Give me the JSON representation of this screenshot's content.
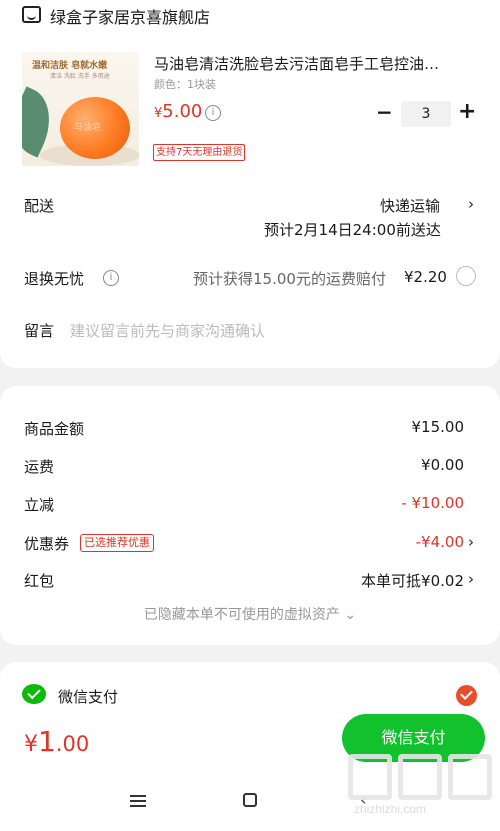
{
  "shop": {
    "name": "绿盒子家居京喜旗舰店",
    "icon": "shop-icon"
  },
  "product": {
    "title": "马油皂清洁洗脸皂去污洁面皂手工皂控油…",
    "variant": "颜色：1块装",
    "price_currency": "¥",
    "price_value": "5.00",
    "quantity": "3",
    "return_badge": "支持7天无理由退货",
    "image": {
      "tagline": "温和洁肤 皂就水嫩",
      "subline": "清洁 洗脸 洗手 多用途",
      "soap_mark": "马油皂"
    }
  },
  "delivery": {
    "label": "配送",
    "method": "快递运输",
    "eta": "预计2月14日24:00前送达"
  },
  "returns": {
    "label": "退换无忧",
    "desc": "预计获得15.00元的运费赔付",
    "price": "¥2.20"
  },
  "note": {
    "label": "留言",
    "placeholder": "建议留言前先与商家沟通确认"
  },
  "summary": {
    "goods_label": "商品金额",
    "goods_value": "¥15.00",
    "shipping_label": "运费",
    "shipping_value": "¥0.00",
    "discount_label": "立减",
    "discount_value": "- ¥10.00",
    "coupon_label": "优惠券",
    "coupon_badge": "已选推荐优惠",
    "coupon_value": "-¥4.00",
    "redpacket_label": "红包",
    "redpacket_value": "本单可抵¥0.02",
    "hidden_assets": "已隐藏本单不可使用的虚拟资产 ⌄"
  },
  "payment": {
    "method_label": "微信支付",
    "total_currency": "¥",
    "total_int": "1",
    "total_dec": ".00",
    "pay_button": "微信支付"
  },
  "watermark": {
    "text": "zhizhizhi.com"
  },
  "colors": {
    "accent_red": "#e0342a",
    "wechat_green": "#11c12d"
  }
}
